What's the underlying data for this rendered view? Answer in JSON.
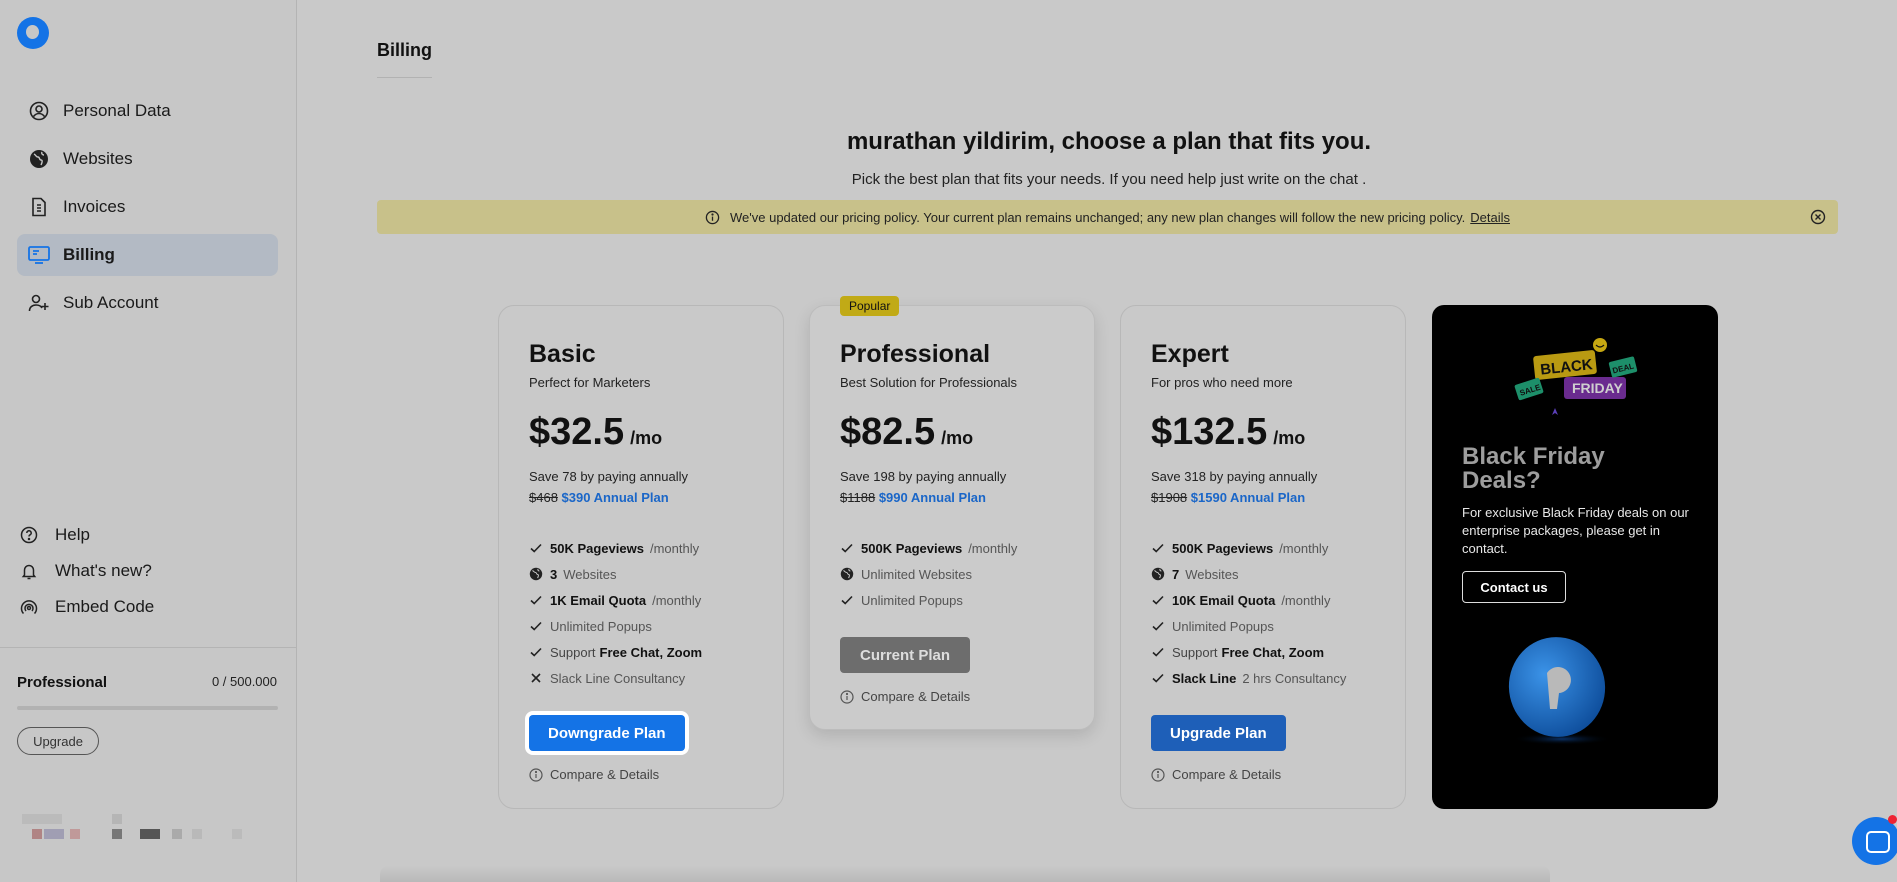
{
  "sidebar": {
    "items": [
      {
        "label": "Personal Data",
        "icon": "user-circle-icon"
      },
      {
        "label": "Websites",
        "icon": "globe-icon"
      },
      {
        "label": "Invoices",
        "icon": "invoice-icon"
      },
      {
        "label": "Billing",
        "icon": "billing-icon",
        "active": true
      },
      {
        "label": "Sub Account",
        "icon": "add-user-icon"
      }
    ],
    "bottom_items": [
      {
        "label": "Help",
        "icon": "question-icon"
      },
      {
        "label": "What's new?",
        "icon": "bell-icon"
      },
      {
        "label": "Embed Code",
        "icon": "broadcast-icon"
      }
    ],
    "plan": {
      "name": "Professional",
      "usage": "0 / 500.000",
      "usage_fraction": 0
    },
    "upgrade_label": "Upgrade"
  },
  "page": {
    "tab": "Billing",
    "headline": "murathan yildirim, choose a plan that fits you.",
    "subline": "Pick the best plan that fits your needs. If you need help just write on the chat ."
  },
  "notice": {
    "text": "We've updated our pricing policy. Your current plan remains unchanged; any new plan changes will follow the new pricing policy.",
    "link": "Details"
  },
  "plans": [
    {
      "name": "Basic",
      "tagline": "Perfect for Marketers",
      "price": "$32.5",
      "per": "/mo",
      "save": "Save 78 by paying annually",
      "old_price": "$468",
      "annual": "$390 Annual Plan",
      "features": [
        {
          "icon": "check-icon",
          "bold": "50K Pageviews",
          "text": "/monthly"
        },
        {
          "icon": "globe-icon",
          "bold": "3",
          "text": "Websites"
        },
        {
          "icon": "check-icon",
          "bold": "1K Email Quota",
          "text": "/monthly"
        },
        {
          "icon": "check-icon",
          "text": "Unlimited Popups"
        },
        {
          "icon": "check-icon",
          "pre": "Support",
          "bold": "Free Chat, Zoom"
        },
        {
          "icon": "x-icon",
          "text": "Slack Line Consultancy"
        }
      ],
      "button": "Downgrade Plan",
      "compare": "Compare & Details"
    },
    {
      "name": "Professional",
      "badge": "Popular",
      "tagline": "Best Solution for Professionals",
      "price": "$82.5",
      "per": "/mo",
      "save": "Save 198 by paying annually",
      "old_price": "$1188",
      "annual": "$990 Annual Plan",
      "features": [
        {
          "icon": "check-icon",
          "bold": "500K Pageviews",
          "text": "/monthly"
        },
        {
          "icon": "globe-icon",
          "text": "Unlimited Websites"
        },
        {
          "icon": "check-icon",
          "text": "Unlimited Popups"
        }
      ],
      "button": "Current Plan",
      "compare": "Compare & Details"
    },
    {
      "name": "Expert",
      "tagline": "For pros who need more",
      "price": "$132.5",
      "per": "/mo",
      "save": "Save 318 by paying annually",
      "old_price": "$1908",
      "annual": "$1590 Annual Plan",
      "features": [
        {
          "icon": "check-icon",
          "bold": "500K Pageviews",
          "text": "/monthly"
        },
        {
          "icon": "globe-icon",
          "bold": "7",
          "text": "Websites"
        },
        {
          "icon": "check-icon",
          "bold": "10K Email Quota",
          "text": "/monthly"
        },
        {
          "icon": "check-icon",
          "text": "Unlimited Popups"
        },
        {
          "icon": "check-icon",
          "pre": "Support",
          "bold": "Free Chat, Zoom"
        },
        {
          "icon": "check-icon",
          "bold": "Slack Line",
          "text": "2 hrs Consultancy"
        }
      ],
      "button": "Upgrade Plan",
      "compare": "Compare & Details"
    }
  ],
  "promo": {
    "art_words": [
      "BLACK",
      "FRIDAY",
      "SALE",
      "DEAL"
    ],
    "title": "Black Friday Deals?",
    "text": "For exclusive Black Friday deals on our enterprise packages, please get in contact.",
    "button": "Contact us"
  },
  "colors": {
    "accent": "#1473e6",
    "notice_bg": "#c8c18a",
    "badge": "#c1aa16"
  }
}
